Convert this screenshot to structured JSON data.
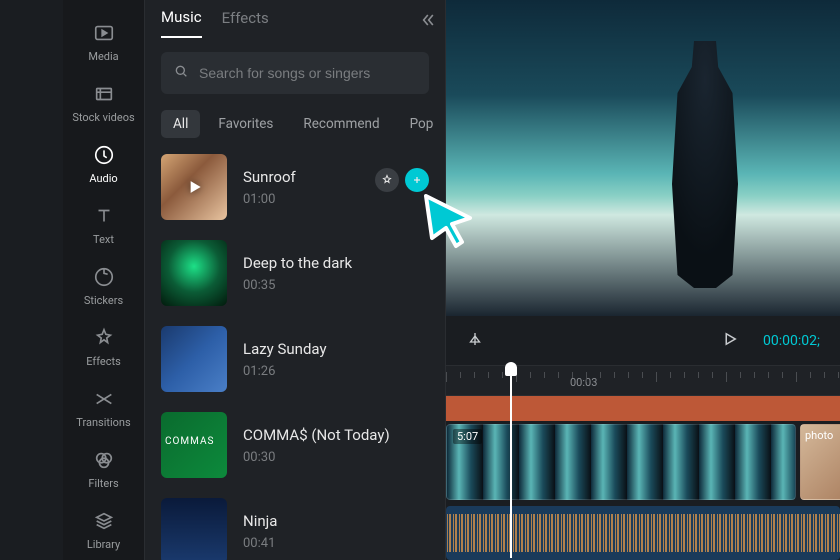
{
  "nav": [
    {
      "id": "media",
      "label": "Media"
    },
    {
      "id": "stock",
      "label": "Stock videos"
    },
    {
      "id": "audio",
      "label": "Audio"
    },
    {
      "id": "text",
      "label": "Text"
    },
    {
      "id": "stickers",
      "label": "Stickers"
    },
    {
      "id": "effects",
      "label": "Effects"
    },
    {
      "id": "transitions",
      "label": "Transitions"
    },
    {
      "id": "filters",
      "label": "Filters"
    },
    {
      "id": "library",
      "label": "Library"
    }
  ],
  "nav_active": "audio",
  "panel": {
    "tabs": [
      {
        "id": "music",
        "label": "Music"
      },
      {
        "id": "effects",
        "label": "Effects"
      }
    ],
    "active_tab": "music",
    "search_placeholder": "Search for songs or singers",
    "chips": [
      "All",
      "Favorites",
      "Recommend",
      "Pop"
    ],
    "active_chip": "All"
  },
  "songs": [
    {
      "id": "sunroof",
      "title": "Sunroof",
      "duration": "01:00",
      "hover": true
    },
    {
      "id": "deep",
      "title": "Deep to the dark",
      "duration": "00:35"
    },
    {
      "id": "lazy",
      "title": "Lazy Sunday",
      "duration": "01:26"
    },
    {
      "id": "commas",
      "title": "COMMA$ (Not Today)",
      "duration": "00:30"
    },
    {
      "id": "ninja",
      "title": "Ninja",
      "duration": "00:41"
    }
  ],
  "timeline": {
    "timecode": "00:00:02;",
    "ruler_labels": [
      "00:03"
    ],
    "clip_main_label": "5:07",
    "clip_photo_label": "photo"
  },
  "colors": {
    "accent": "#00c9d4"
  }
}
